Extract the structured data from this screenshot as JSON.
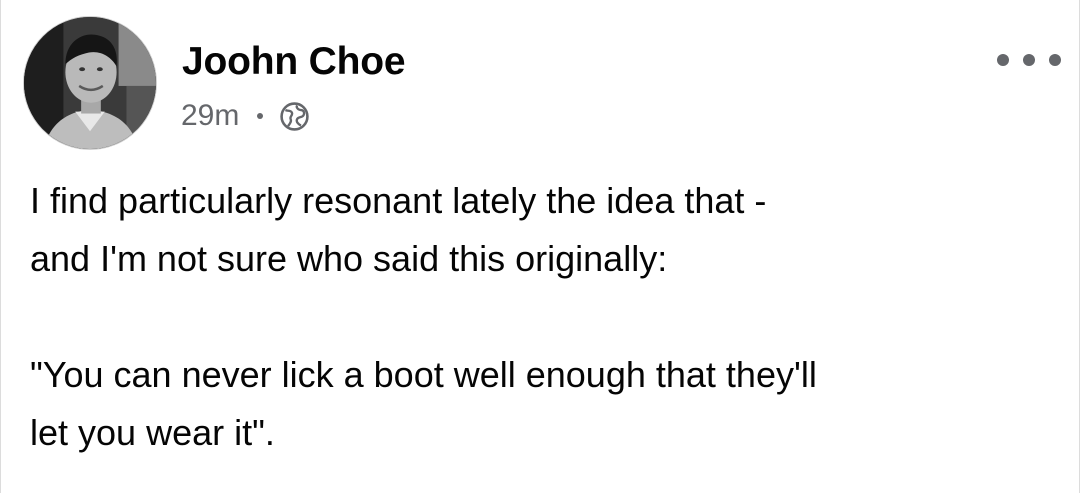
{
  "post": {
    "author": "Joohn Choe",
    "timestamp": "29m",
    "privacy_icon": "globe-icon",
    "more_icon": "more-options-icon",
    "text_lines": [
      "I find particularly resonant lately the idea that -",
      "and I'm not sure who said this originally:",
      "\"You can never lick a boot well enough that they'll",
      "let you wear it\"."
    ]
  },
  "colors": {
    "primary_text": "#050505",
    "secondary_text": "#65676b",
    "background": "#ffffff"
  }
}
